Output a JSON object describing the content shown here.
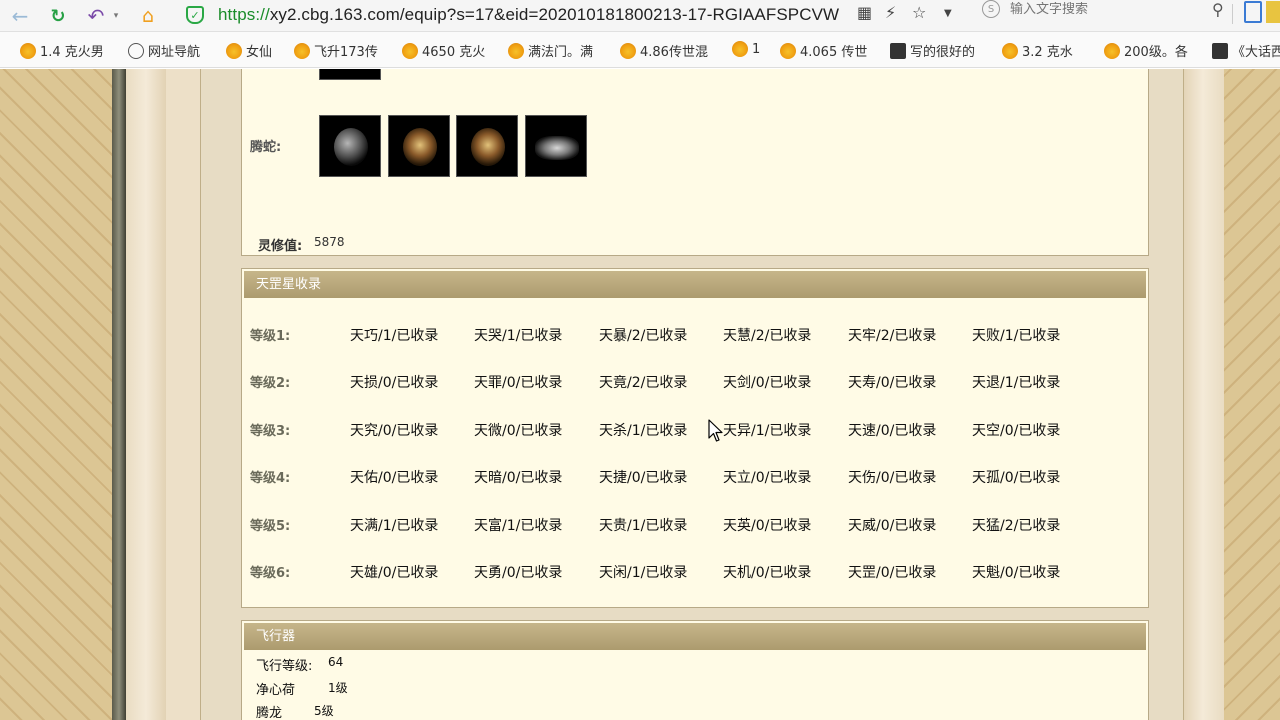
{
  "browser": {
    "url_scheme": "https://",
    "url_rest": "xy2.cbg.163.com/equip?s=17&eid=202010181800213-17-RGIAAFSPCVW",
    "search_placeholder": "输入文字搜索",
    "back_icon": "back-arrow-icon",
    "reload_icon": "reload-icon",
    "undo_icon": "undo-icon",
    "home_icon": "home-icon"
  },
  "bookmarks": [
    {
      "label": "1.4 克火男",
      "icon": "game-favicon"
    },
    {
      "label": "网址导航",
      "icon": "globe-icon"
    },
    {
      "label": "女仙",
      "icon": "game-favicon"
    },
    {
      "label": "飞升173传",
      "icon": "game-favicon"
    },
    {
      "label": "4650 克火",
      "icon": "game-favicon"
    },
    {
      "label": "满法门。满",
      "icon": "game-favicon"
    },
    {
      "label": "4.86传世混",
      "icon": "game-favicon"
    },
    {
      "label": "1",
      "icon": "game-favicon"
    },
    {
      "label": "4.065 传世",
      "icon": "game-favicon"
    },
    {
      "label": "写的很好的",
      "icon": "dark-favicon"
    },
    {
      "label": "3.2  克水",
      "icon": "game-favicon"
    },
    {
      "label": "200级。各",
      "icon": "game-favicon"
    },
    {
      "label": "《大话西",
      "icon": "dark-favicon"
    }
  ],
  "equipment": {
    "tengshe_label": "腾蛇:",
    "lingxiu_label": "灵修值:",
    "lingxiu_value": "5878"
  },
  "stars": {
    "title": "天罡星收录",
    "rows": [
      {
        "level": "等级1:",
        "cells": [
          "天巧/1/已收录",
          "天哭/1/已收录",
          "天暴/2/已收录",
          "天慧/2/已收录",
          "天牢/2/已收录",
          "天败/1/已收录"
        ]
      },
      {
        "level": "等级2:",
        "cells": [
          "天损/0/已收录",
          "天罪/0/已收录",
          "天竟/2/已收录",
          "天剑/0/已收录",
          "天寿/0/已收录",
          "天退/1/已收录"
        ]
      },
      {
        "level": "等级3:",
        "cells": [
          "天究/0/已收录",
          "天微/0/已收录",
          "天杀/1/已收录",
          "天异/1/已收录",
          "天速/0/已收录",
          "天空/0/已收录"
        ]
      },
      {
        "level": "等级4:",
        "cells": [
          "天佑/0/已收录",
          "天暗/0/已收录",
          "天捷/0/已收录",
          "天立/0/已收录",
          "天伤/0/已收录",
          "天孤/0/已收录"
        ]
      },
      {
        "level": "等级5:",
        "cells": [
          "天满/1/已收录",
          "天富/1/已收录",
          "天贵/1/已收录",
          "天英/0/已收录",
          "天威/0/已收录",
          "天猛/2/已收录"
        ]
      },
      {
        "level": "等级6:",
        "cells": [
          "天雄/0/已收录",
          "天勇/0/已收录",
          "天闲/1/已收录",
          "天机/0/已收录",
          "天罡/0/已收录",
          "天魁/0/已收录"
        ]
      }
    ]
  },
  "flyer": {
    "title": "飞行器",
    "level_label": "飞行等级:",
    "level_value": "64",
    "items": [
      {
        "name": "净心荷",
        "level": "1级"
      },
      {
        "name": "腾龙",
        "level": "5级"
      }
    ]
  }
}
